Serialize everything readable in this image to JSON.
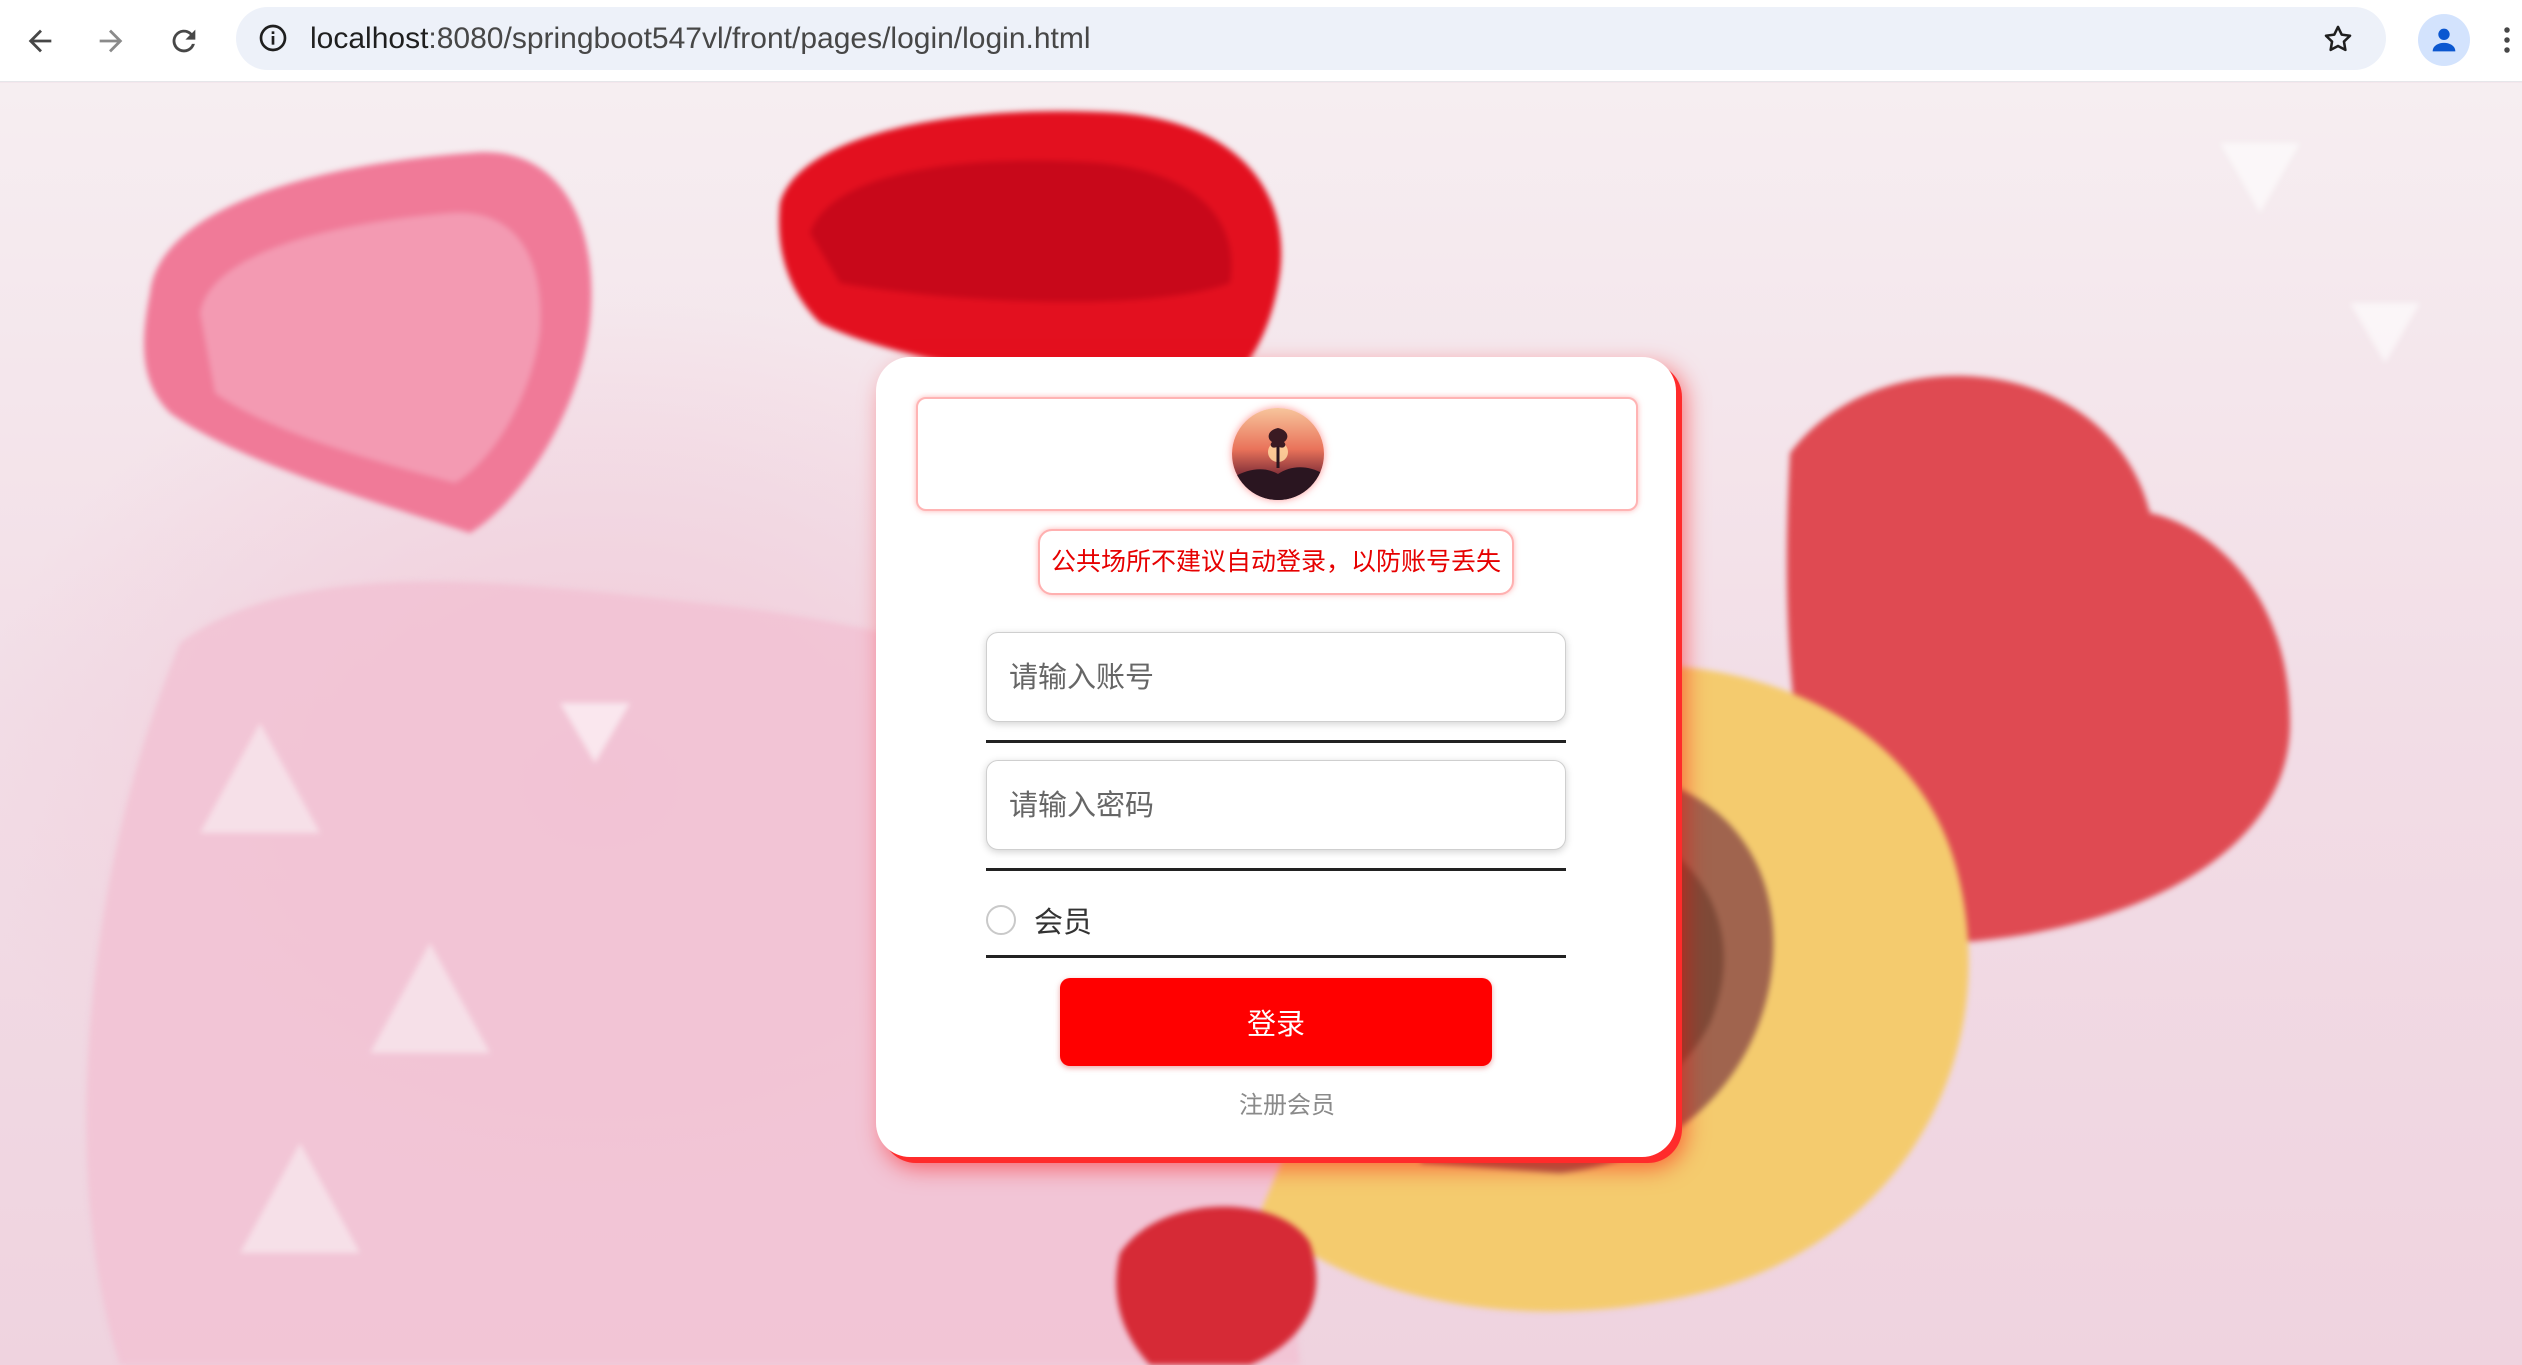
{
  "browser": {
    "url_host": "localhost",
    "url_path": ":8080/springboot547vl/front/pages/login/login.html",
    "icons": {
      "back": "arrow-left-icon",
      "forward": "arrow-right-icon",
      "reload": "reload-icon",
      "site_info": "info-icon",
      "bookmark": "star-icon",
      "profile": "person-icon",
      "menu": "more-vert-icon"
    }
  },
  "login": {
    "notice": "公共场所不建议自动登录，以防账号丢失",
    "account_placeholder": "请输入账号",
    "password_placeholder": "请输入密码",
    "role_label": "会员",
    "role_selected": false,
    "submit_label": "登录",
    "register_link": "注册会员"
  },
  "colors": {
    "accent": "#ff0000",
    "notice_text": "#e60000",
    "card_shadow": "#ff2b2b"
  }
}
